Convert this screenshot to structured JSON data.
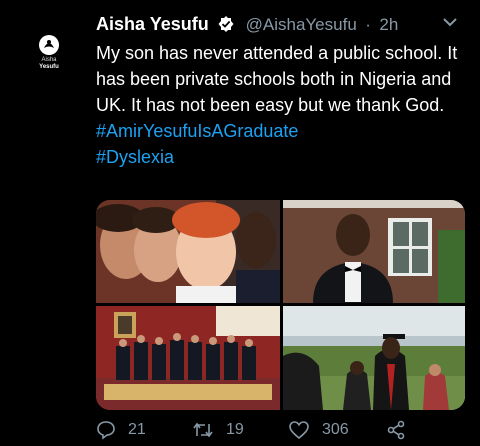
{
  "tweet": {
    "author_name": "Aisha Yesufu",
    "handle": "@AishaYesufu",
    "separator": "·",
    "time": "2h",
    "verified": true,
    "avatar": {
      "line1": "Aisha",
      "line2": "Yesufu"
    },
    "text": "My son has never attended a public school. It has been private schools both in Nigeria and UK. It has not been easy but we thank God.",
    "hashtags": [
      "#AmirYesufuIsAGraduate",
      "#Dyslexia"
    ],
    "media": [
      {
        "icon": "group-selfie-photo"
      },
      {
        "icon": "graduate-portrait-photo"
      },
      {
        "icon": "graduation-class-photo"
      },
      {
        "icon": "graduation-ceremony-photo"
      }
    ],
    "stats": {
      "replies": "21",
      "retweets": "19",
      "likes": "306"
    }
  },
  "colors": {
    "background": "#000000",
    "link": "#1da1f2",
    "muted": "#8899a6",
    "verified": "#ffffff"
  }
}
